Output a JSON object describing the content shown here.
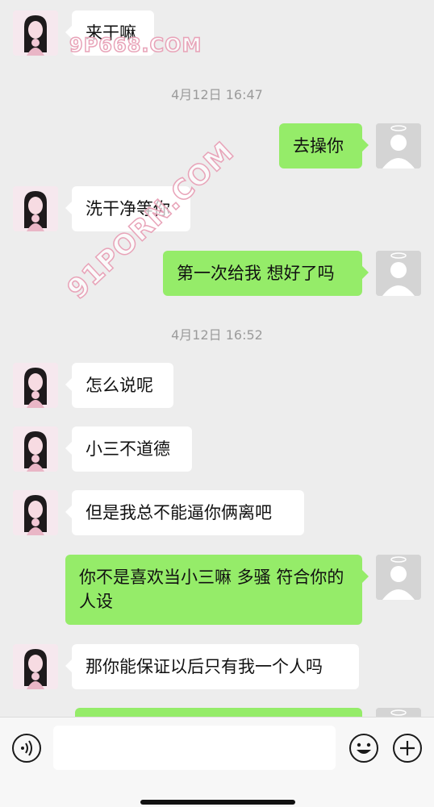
{
  "timestamps": [
    "4月12日 16:47",
    "4月12日 16:52"
  ],
  "messages": [
    {
      "from": "her",
      "text": "来干嘛"
    },
    {
      "from": "me",
      "text": "去操你"
    },
    {
      "from": "her",
      "text": "洗干净等你"
    },
    {
      "from": "me",
      "text": "第一次给我 想好了吗"
    },
    {
      "from": "her",
      "text": "怎么说呢"
    },
    {
      "from": "her",
      "text": "小三不道德"
    },
    {
      "from": "her",
      "text": "但是我总不能逼你俩离吧"
    },
    {
      "from": "me",
      "text": "你不是喜欢当小三嘛 多骚 符合你的人设"
    },
    {
      "from": "her",
      "text": "那你能保证以后只有我一个人吗"
    }
  ],
  "watermarks": [
    "9P668.COM",
    "91PORN.COM"
  ],
  "toolbar": {
    "left_icon": "voice-icon",
    "right_icons": [
      "emoji-icon",
      "plus-icon"
    ],
    "input_value": ""
  },
  "colors": {
    "background": "#ededed",
    "incoming_bubble": "#ffffff",
    "outgoing_bubble": "#95ec69",
    "timestamp_text": "#9b9b9b",
    "toolbar_bg": "#f7f7f7"
  }
}
